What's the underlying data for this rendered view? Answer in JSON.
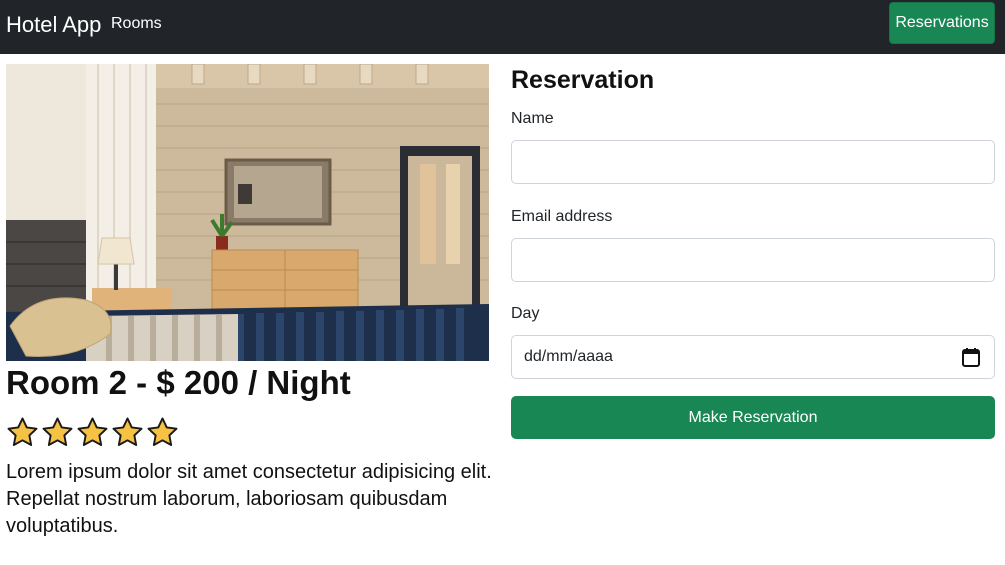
{
  "navbar": {
    "brand": "Hotel App",
    "links": [
      "Rooms"
    ],
    "reservations_button": "Reservations"
  },
  "room": {
    "title": "Room 2 - $ 200 / Night",
    "rating": 5,
    "rating_max": 5,
    "description": "Lorem ipsum dolor sit amet consectetur adipisicing elit. Repellat nostrum laborum, laboriosam quibusdam voluptatibus."
  },
  "form": {
    "title": "Reservation",
    "name_label": "Name",
    "name_value": "",
    "email_label": "Email address",
    "email_value": "",
    "day_label": "Day",
    "day_placeholder": "dd/mm/aaaa",
    "submit_label": "Make Reservation"
  },
  "colors": {
    "navbar_bg": "#212529",
    "primary_green": "#198754",
    "star_fill": "#f6c244"
  }
}
